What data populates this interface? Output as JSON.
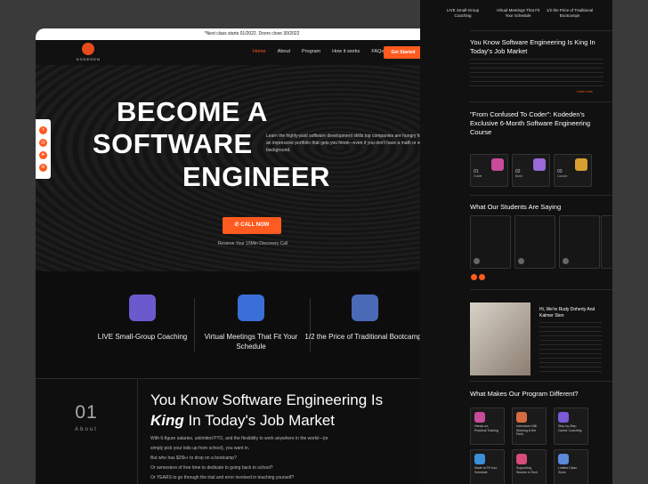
{
  "topbar": {
    "text": "*Next class starts 01/2022. Doors close 30/2022"
  },
  "nav": {
    "logo_text": "KODEDEN",
    "links": [
      "Home",
      "About",
      "Program",
      "How it works",
      "FAQs"
    ],
    "cta_label": "Get Started"
  },
  "social": {
    "icons": [
      "twitter-icon",
      "instagram-icon",
      "telegram-icon",
      "linkedin-icon"
    ],
    "glyphs": [
      "t",
      "◎",
      "➤",
      "in"
    ]
  },
  "hero": {
    "line1": "BECOME A",
    "line2": "SOFTWARE",
    "line3": "ENGINEER",
    "copy": "Learn the highly-paid software development skills top companies are hungry for and build an impressive portfolio that gets you hired—even if you don't have a math or science background.",
    "call_label": "CALL NOW",
    "reserve": "Reserve Your 15Min Discovery Call"
  },
  "features": [
    {
      "title": "LIVE Small-Group Coaching"
    },
    {
      "title": "Virtual Meetings That Fit Your Schedule"
    },
    {
      "title": "1/2 the Price of Traditional Bootcamps"
    }
  ],
  "about": {
    "number": "01",
    "label": "About",
    "heading_pre": "You Know Software Engineering Is",
    "heading_em": "King",
    "heading_post": "In Today's Job Market",
    "paragraphs": [
      "With 6-figure salaries, unlimited PTO, and the flexibility to work anywhere in the world—(or",
      "simply pick your kids up from school), you want in.",
      "But who has $25k+ to drop on a bootcamp?",
      "Or semesters of free time to dedicate to going back to school?",
      "Or YEARS to go through the trial and error involved in teaching yourself?"
    ]
  },
  "side": {
    "features": [
      "LIVE Small-Group Coaching",
      "Virtual Meetings That Fit Your Schedule",
      "1/2 the Price of Traditional Bootcamps"
    ],
    "about_heading": "You Know Software Engineering Is King In Today's Job Market",
    "learn_more": "Learn more",
    "course_heading": "\"From Confused To Coder\": Kodeden's Exclusive 6-Month Software Engineering Course",
    "steps": [
      {
        "num": "01",
        "title": "Guide"
      },
      {
        "num": "02",
        "title": "Build"
      },
      {
        "num": "03",
        "title": "Launch"
      }
    ],
    "students_heading": "What Our Students Are Saying",
    "founders_heading": "Hi, We're Rudy Doherty And Kalmer Sten",
    "program_heading": "What Makes Our Program Different?",
    "program_items": [
      "Hands-on, Practical Training",
      "Instructors Still Working in the Field",
      "Step-by-Step Career Coaching",
      "Made to Fit Your Schedule",
      "Supporting Women in Tech",
      "Limited Class Sizes"
    ]
  },
  "colors": {
    "accent": "#ff5a1f"
  }
}
